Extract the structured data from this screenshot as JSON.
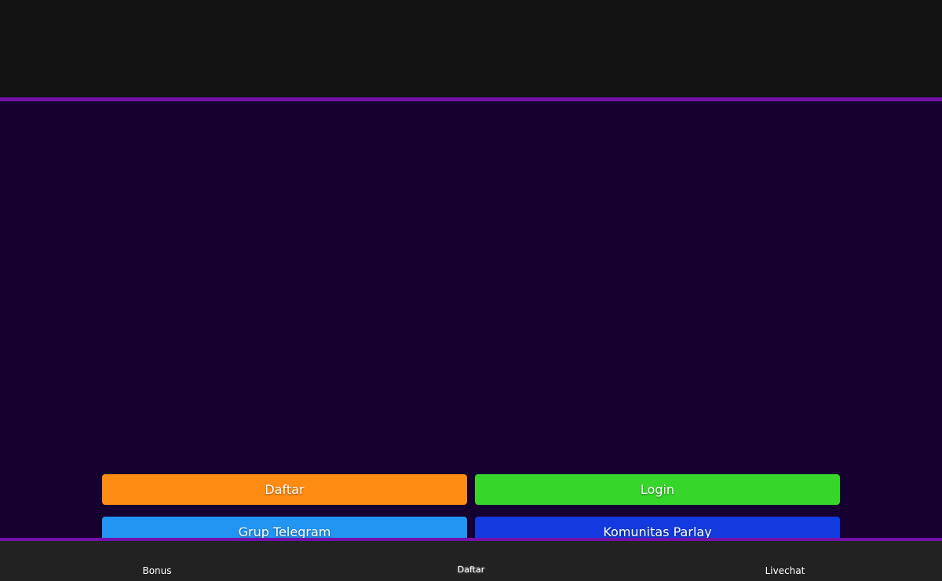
{
  "colors": {
    "page_bg": "#150030",
    "header_bg": "#131313",
    "accent_purple": "#7210a8",
    "bottom_nav_bg": "#222222",
    "daftar_orange": "#ff8c12",
    "login_green": "#37d62b",
    "telegram_blue": "#2294f2",
    "parlay_blue": "#123adf"
  },
  "buttons": {
    "daftar": "Daftar",
    "login": "Login",
    "telegram": "Grup Telegram",
    "parlay": "Komunitas Parlay"
  },
  "bottom_nav": {
    "items": [
      {
        "label": "Bonus"
      },
      {
        "label": "Daftar"
      },
      {
        "label": "Livechat"
      }
    ]
  }
}
